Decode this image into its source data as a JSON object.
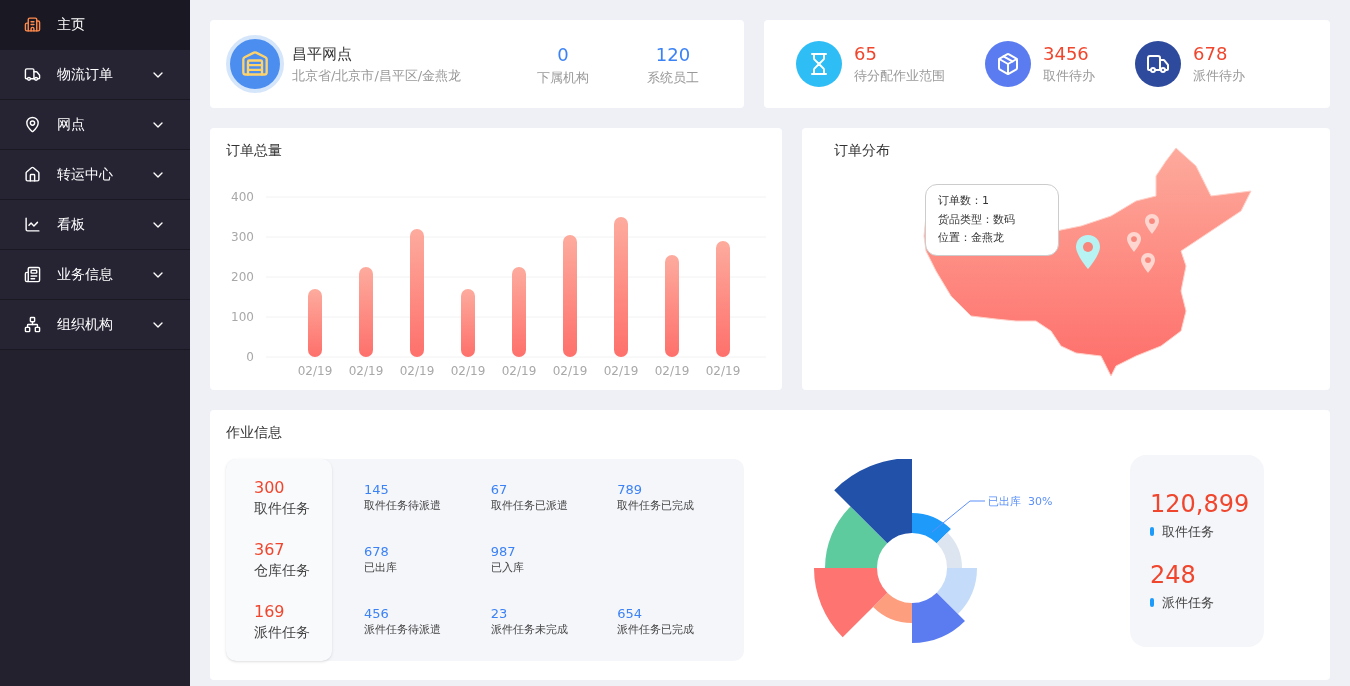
{
  "sidebar": {
    "items": [
      {
        "label": "主页",
        "selected": true,
        "submenu": false
      },
      {
        "label": "物流订单",
        "selected": false,
        "submenu": true
      },
      {
        "label": "网点",
        "selected": false,
        "submenu": true
      },
      {
        "label": "转运中心",
        "selected": false,
        "submenu": true
      },
      {
        "label": "看板",
        "selected": false,
        "submenu": true
      },
      {
        "label": "业务信息",
        "selected": false,
        "submenu": true
      },
      {
        "label": "组织机构",
        "selected": false,
        "submenu": true
      }
    ]
  },
  "station": {
    "name": "昌平网点",
    "address": "北京省/北京市/昌平区/金燕龙",
    "stats": [
      {
        "value": "0",
        "label": "下属机构"
      },
      {
        "value": "120",
        "label": "系统员工"
      }
    ]
  },
  "todos": [
    {
      "kind": "range",
      "value": "65",
      "label": "待分配作业范围"
    },
    {
      "kind": "pickup",
      "value": "3456",
      "label": "取件待办"
    },
    {
      "kind": "delivery",
      "value": "678",
      "label": "派件待办"
    }
  ],
  "order_total": {
    "title": "订单总量",
    "chart_data": {
      "type": "bar",
      "categories": [
        "02/19",
        "02/19",
        "02/19",
        "02/19",
        "02/19",
        "02/19",
        "02/19",
        "02/19",
        "02/19"
      ],
      "values": [
        170,
        225,
        320,
        170,
        225,
        305,
        350,
        255,
        290
      ],
      "ylim": [
        0,
        400
      ],
      "yticks": [
        0,
        100,
        200,
        300,
        400
      ],
      "grid": true
    }
  },
  "order_map": {
    "title": "订单分布",
    "tooltip": [
      "订单数：1",
      "货品类型：数码",
      "位置：金燕龙"
    ]
  },
  "work_info": {
    "title": "作业信息",
    "groups": [
      {
        "value": "300",
        "label": "取件任务",
        "items": [
          {
            "value": "145",
            "label": "取件任务待派遣"
          },
          {
            "value": "67",
            "label": "取件任务已派遣"
          },
          {
            "value": "789",
            "label": "取件任务已完成"
          }
        ]
      },
      {
        "value": "367",
        "label": "仓库任务",
        "items": [
          {
            "value": "678",
            "label": "已出库"
          },
          {
            "value": "987",
            "label": "已入库"
          }
        ]
      },
      {
        "value": "169",
        "label": "派件任务",
        "items": [
          {
            "value": "456",
            "label": "派件任务待派遣"
          },
          {
            "value": "23",
            "label": "派件任务未完成"
          },
          {
            "value": "654",
            "label": "派件任务已完成"
          }
        ]
      }
    ],
    "rose_label": "已出库  30%",
    "totals": [
      {
        "value": "120,899",
        "label": "取件任务"
      },
      {
        "value": "248",
        "label": "派件任务"
      }
    ]
  }
}
